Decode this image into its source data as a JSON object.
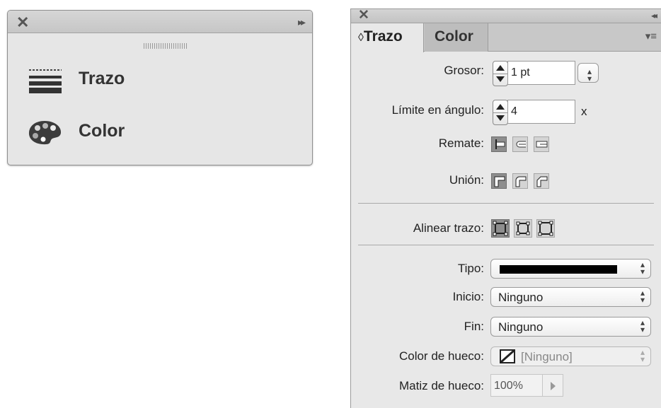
{
  "left_panel": {
    "close_glyph": "✕",
    "expand_glyph": "▸▸",
    "items": [
      {
        "label": "Trazo",
        "icon": "stroke-icon"
      },
      {
        "label": "Color",
        "icon": "palette-icon"
      }
    ]
  },
  "right_panel": {
    "close_glyph": "✕",
    "collapse_glyph": "◂◂",
    "menu_glyph": "▾≡",
    "tabs": [
      {
        "label": "Trazo",
        "prefix": "◊",
        "active": true
      },
      {
        "label": "Color",
        "active": false
      }
    ],
    "grosor": {
      "label": "Grosor:",
      "value": "1 pt"
    },
    "limite": {
      "label": "Límite en ángulo:",
      "value": "4",
      "suffix": "x"
    },
    "remate": {
      "label": "Remate:"
    },
    "union": {
      "label": "Unión:"
    },
    "alinear": {
      "label": "Alinear trazo:"
    },
    "tipo": {
      "label": "Tipo:",
      "swatch_color": "#000000"
    },
    "inicio": {
      "label": "Inicio:",
      "value": "Ninguno"
    },
    "fin": {
      "label": "Fin:",
      "value": "Ninguno"
    },
    "color_hueco": {
      "label": "Color de hueco:",
      "value": "[Ninguno]"
    },
    "matiz_hueco": {
      "label": "Matiz de hueco:",
      "value": "100%"
    }
  }
}
